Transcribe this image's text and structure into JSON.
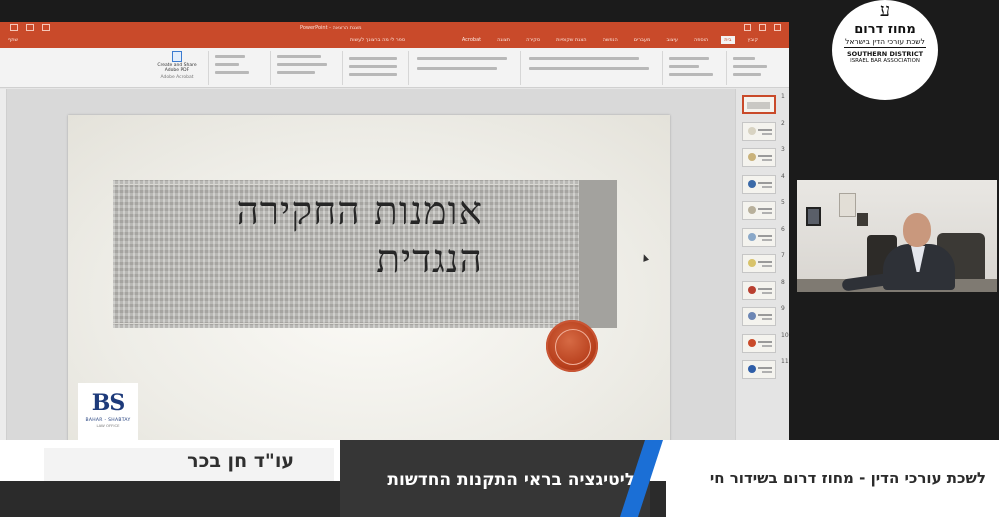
{
  "window": {
    "title": "PowerPoint - מצגת הרצאה"
  },
  "ribbon": {
    "tabs": [
      "קובץ",
      "בית",
      "הוספה",
      "עיצוב",
      "מעברים",
      "הנפשה",
      "הצגת שקופיות",
      "סקירה",
      "תצוגה",
      "Acrobat"
    ],
    "active_tab_index": 1,
    "tell_me": "ספר לי מה ברצונך לעשות",
    "share": "שתף",
    "adobe_button": "Create and Share Adobe PDF",
    "adobe_group": "Adobe Acrobat"
  },
  "slide": {
    "title_line1": "אומנות החקירה",
    "title_line2": "הנגדית",
    "logo_monogram": "BS",
    "logo_firm": "BAHAR - SHABTAY",
    "logo_sub": "LAW OFFICE"
  },
  "thumbnails": {
    "numbers": [
      "1",
      "2",
      "3",
      "4",
      "5",
      "6",
      "7",
      "8",
      "9",
      "10",
      "11"
    ],
    "active_index": 0
  },
  "badge": {
    "mark": "ע",
    "title_he": "מחוז דרום",
    "subtitle_he": "לשכת עורכי הדין בישראל",
    "title_en": "SOUTHERN DISTRICT",
    "subtitle_en": "ISRAEL BAR ASSOCIATION"
  },
  "lower_third": {
    "speaker": "עו\"ד חן בכר",
    "topic": "ליטיגציה בראי התקנות החדשות",
    "channel": "לשכת עורכי הדין - מחוז דרום בשידור חי"
  },
  "colors": {
    "ppt_accent": "#c94a2a",
    "broadcast_blue": "#1b6fd6",
    "background": "#1b1b1b"
  }
}
